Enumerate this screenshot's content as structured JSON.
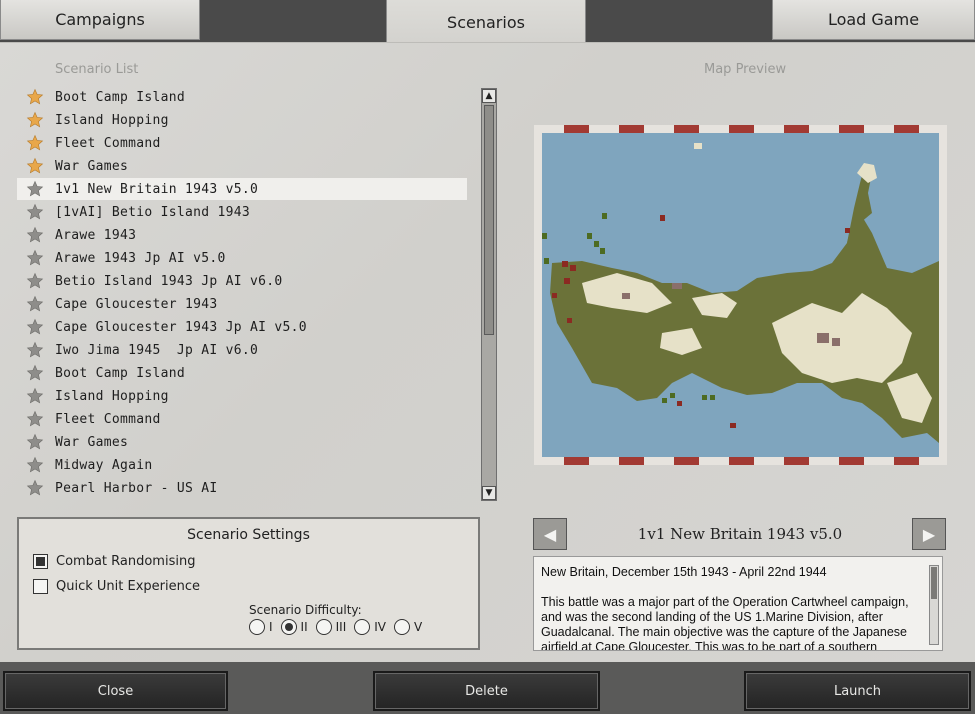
{
  "tabs": [
    {
      "label": "Campaigns"
    },
    {
      "label": "Scenarios"
    },
    {
      "label": "Load Game"
    }
  ],
  "scenario_list": {
    "title": "Scenario List",
    "items": [
      {
        "label": "Boot Camp Island",
        "star": "gold-star"
      },
      {
        "label": "Island Hopping",
        "star": "gold-star"
      },
      {
        "label": "Fleet Command",
        "star": "gold-star"
      },
      {
        "label": "War Games",
        "star": "gold-star"
      },
      {
        "label": "1v1 New Britain 1943 v5.0",
        "star": "gray-star",
        "selected": true
      },
      {
        "label": "[1vAI] Betio Island 1943",
        "star": "gray-star"
      },
      {
        "label": "Arawe 1943",
        "star": "gray-star"
      },
      {
        "label": "Arawe 1943 Jp AI v5.0",
        "star": "gray-star"
      },
      {
        "label": "Betio Island 1943 Jp AI v6.0",
        "star": "gray-star"
      },
      {
        "label": "Cape Gloucester 1943",
        "star": "gray-star"
      },
      {
        "label": "Cape Gloucester 1943 Jp AI v5.0",
        "star": "gray-star"
      },
      {
        "label": "Iwo Jima 1945  Jp AI v6.0",
        "star": "gray-star"
      },
      {
        "label": "Boot Camp Island",
        "star": "gray-star"
      },
      {
        "label": "Island Hopping",
        "star": "gray-star"
      },
      {
        "label": "Fleet Command",
        "star": "gray-star"
      },
      {
        "label": "War Games",
        "star": "gray-star"
      },
      {
        "label": "Midway Again",
        "star": "gray-star"
      },
      {
        "label": "Pearl Harbor - US AI",
        "star": "gray-star"
      }
    ]
  },
  "map_preview": {
    "title": "Map Preview"
  },
  "settings": {
    "title": "Scenario Settings",
    "combat_randomising": {
      "label": "Combat Randomising",
      "checked": true
    },
    "quick_unit_experience": {
      "label": "Quick Unit Experience",
      "checked": false
    },
    "difficulty_label": "Scenario Difficulty:",
    "difficulty_options": [
      "I",
      "II",
      "III",
      "IV",
      "V"
    ],
    "difficulty_selected": "II"
  },
  "selected_scenario": {
    "title": "1v1 New Britain 1943 v5.0",
    "description_line1": "New Britain, December 15th 1943 - April 22nd  1944",
    "description_body": "This battle was a major part of the Operation Cartwheel campaign, and was the second landing of the US 1.Marine Division, after Guadalcanal. The main objective was the capture of the Japanese airfield at Cape Gloucester. This was to be part of a southern"
  },
  "footer": {
    "close_label": "Close",
    "delete_label": "Delete",
    "launch_label": "Launch"
  },
  "colors": {
    "gold_star": "#e8a74a",
    "gray_star": "#8e8d8a",
    "sea": "#7fa5be",
    "land": "#6b7239",
    "clear_terrain": "#e6e1c8",
    "us_units": "#8b2a22",
    "jp_units": "#4d6b22"
  }
}
